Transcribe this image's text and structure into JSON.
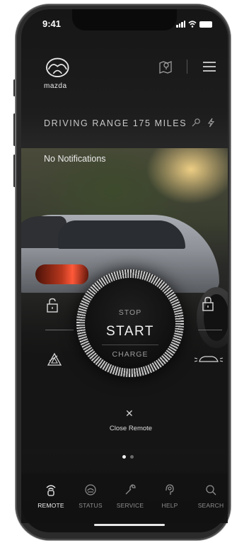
{
  "status_bar": {
    "time": "9:41"
  },
  "header": {
    "logo_word": "mazda",
    "range_text": "DRIVING RANGE 175 MILES",
    "icons": [
      "logo-icon",
      "map-pin-icon",
      "menu-icon",
      "location-icon",
      "bolt-icon"
    ]
  },
  "notifications": {
    "text": "No Notifications"
  },
  "controls": {
    "left_top": "lock-icon",
    "left_bottom": "hazard-icon",
    "right_top": "lock-icon",
    "right_bottom": "car-lights-icon"
  },
  "dial": {
    "stop_label": "STOP",
    "start_label": "START",
    "charge_label": "CHARGE"
  },
  "close": {
    "icon": "close-icon",
    "label": "Close Remote"
  },
  "pager": {
    "count": 2,
    "active_index": 0
  },
  "tabs": [
    {
      "label": "REMOTE",
      "icon": "remote-icon",
      "active": true
    },
    {
      "label": "STATUS",
      "icon": "status-icon",
      "active": false
    },
    {
      "label": "SERVICE",
      "icon": "wrench-icon",
      "active": false
    },
    {
      "label": "HELP",
      "icon": "help-icon",
      "active": false
    },
    {
      "label": "SEARCH",
      "icon": "search-icon",
      "active": false
    }
  ],
  "colors": {
    "background": "#1b1b1b",
    "text": "#f2f2f2",
    "muted": "#8d8d8d",
    "taillight": "#d8412a"
  }
}
